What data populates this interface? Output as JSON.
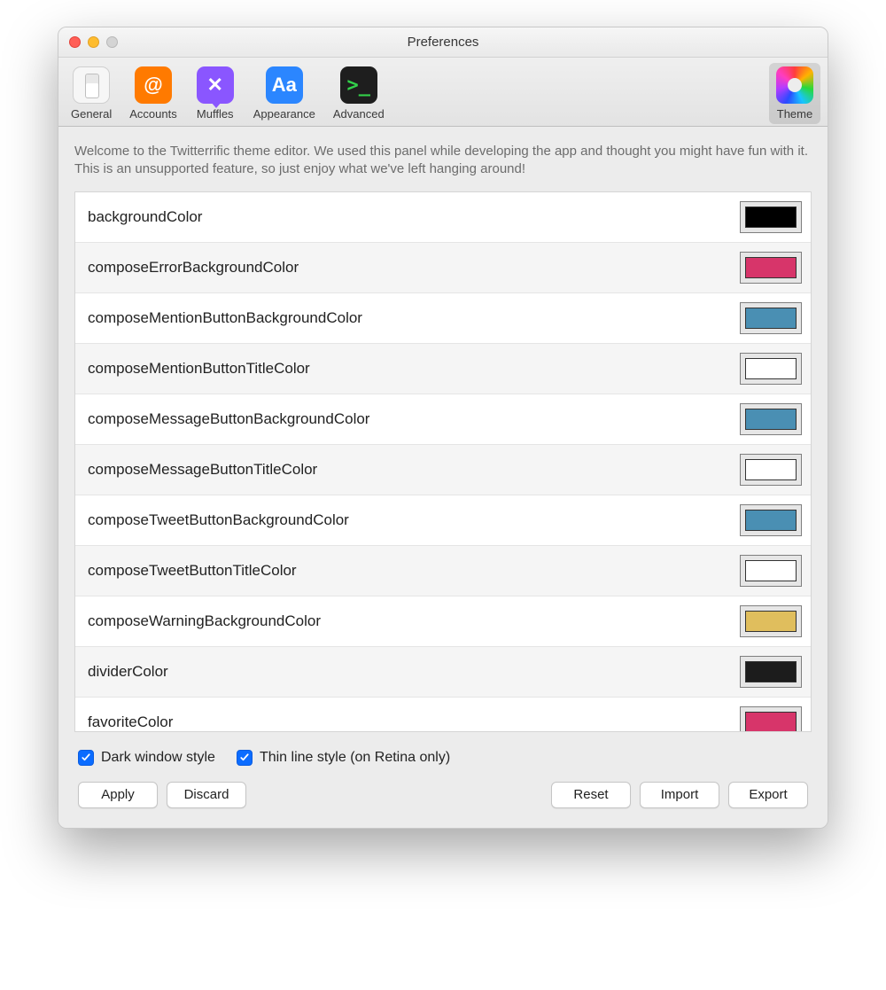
{
  "window": {
    "title": "Preferences"
  },
  "toolbar": {
    "items": [
      {
        "label": "General"
      },
      {
        "label": "Accounts"
      },
      {
        "label": "Muffles"
      },
      {
        "label": "Appearance"
      },
      {
        "label": "Advanced"
      },
      {
        "label": "Theme"
      }
    ],
    "selected": "Theme"
  },
  "intro": "Welcome to the Twitterrific theme editor. We used this panel while developing the app and thought you might have fun with it. This is an unsupported feature, so just enjoy what we've left hanging around!",
  "colors": [
    {
      "name": "backgroundColor",
      "hex": "#000000"
    },
    {
      "name": "composeErrorBackgroundColor",
      "hex": "#d7356a"
    },
    {
      "name": "composeMentionButtonBackgroundColor",
      "hex": "#4a8fb3"
    },
    {
      "name": "composeMentionButtonTitleColor",
      "hex": "#ffffff"
    },
    {
      "name": "composeMessageButtonBackgroundColor",
      "hex": "#4a8fb3"
    },
    {
      "name": "composeMessageButtonTitleColor",
      "hex": "#ffffff"
    },
    {
      "name": "composeTweetButtonBackgroundColor",
      "hex": "#4a8fb3"
    },
    {
      "name": "composeTweetButtonTitleColor",
      "hex": "#ffffff"
    },
    {
      "name": "composeWarningBackgroundColor",
      "hex": "#e0be5d"
    },
    {
      "name": "dividerColor",
      "hex": "#1c1c1c"
    },
    {
      "name": "favoriteColor",
      "hex": "#d7356a"
    }
  ],
  "options": {
    "dark_label": "Dark window style",
    "thin_label": "Thin line style (on Retina only)",
    "dark_checked": true,
    "thin_checked": true
  },
  "buttons": {
    "apply": "Apply",
    "discard": "Discard",
    "reset": "Reset",
    "import": "Import",
    "export": "Export"
  }
}
